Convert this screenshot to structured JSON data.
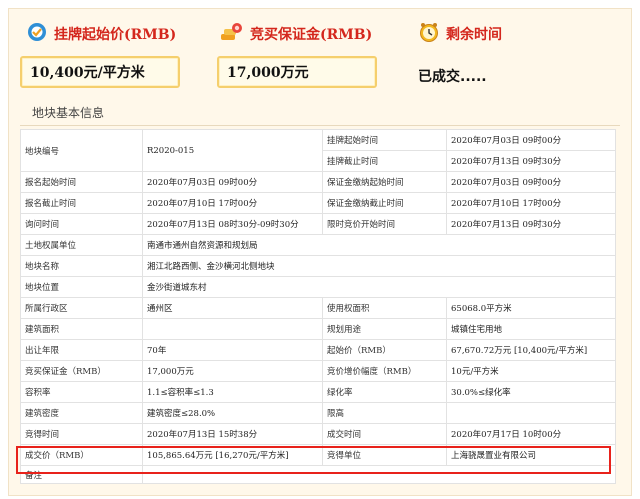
{
  "header": {
    "starting_price_label": "挂牌起始价(RMB)",
    "deposit_label": "竞买保证金(RMB)",
    "time_left_label": "剩余时间",
    "starting_price_value": "10,400元/平方米",
    "deposit_value": "17,000万元",
    "status": "已成交....."
  },
  "icons": {
    "price": "price-tag-icon",
    "deposit": "coin-stack-icon",
    "time": "alarm-clock-icon"
  },
  "section": {
    "title": "地块基本信息"
  },
  "table": {
    "r1": {
      "label_a": "地块编号",
      "value_a": "R2020-015",
      "label_b1": "挂牌起始时间",
      "value_b1": "2020年07月03日 09时00分",
      "label_b2": "挂牌截止时间",
      "value_b2": "2020年07月13日 09时30分"
    },
    "r2": {
      "label_a": "报名起始时间",
      "value_a": "2020年07月03日 09时00分",
      "label_b": "保证金缴纳起始时间",
      "value_b": "2020年07月03日 09时00分"
    },
    "r3": {
      "label_a": "报名截止时间",
      "value_a": "2020年07月10日 17时00分",
      "label_b": "保证金缴纳截止时间",
      "value_b": "2020年07月10日 17时00分"
    },
    "r4": {
      "label_a": "询问时间",
      "value_a": "2020年07月13日 08时30分-09时30分",
      "label_b": "限时竞价开始时间",
      "value_b": "2020年07月13日 09时30分"
    },
    "r5": {
      "label": "土地权属单位",
      "value": "南通市通州自然资源和规划局"
    },
    "r6": {
      "label": "地块名称",
      "value": "湘江北路西侧、金沙横河北侧地块"
    },
    "r7": {
      "label": "地块位置",
      "value": "金沙街道城东村"
    },
    "r8": {
      "label_a": "所属行政区",
      "value_a": "通州区",
      "label_b": "使用权面积",
      "value_b": "65068.0平方米"
    },
    "r9": {
      "label_a": "建筑面积",
      "value_a": "",
      "label_b": "规划用途",
      "value_b": "城镇住宅用地"
    },
    "r10": {
      "label_a": "出让年限",
      "value_a": "70年",
      "label_b": "起始价（RMB）",
      "value_b": "67,670.72万元 [10,400元/平方米]"
    },
    "r11": {
      "label_a": "竞买保证金（RMB）",
      "value_a": "17,000万元",
      "label_b": "竞价增价幅度（RMB）",
      "value_b": "10元/平方米"
    },
    "r12": {
      "label_a": "容积率",
      "value_a": "1.1≤容积率≤1.3",
      "label_b": "绿化率",
      "value_b": "30.0%≤绿化率"
    },
    "r13": {
      "label_a": "建筑密度",
      "value_a": "建筑密度≤28.0%",
      "label_b": "限高",
      "value_b": ""
    },
    "r14": {
      "label_a": "竞得时间",
      "value_a": "2020年07月13日 15时38分",
      "label_b": "成交时间",
      "value_b": "2020年07月17日 10时00分"
    },
    "r15": {
      "label_a": "成交价（RMB）",
      "value_a": "105,865.64万元 [16,270元/平方米]",
      "label_b": "竞得单位",
      "value_b": "上海骁晟置业有限公司"
    },
    "r16": {
      "label": "备注",
      "value": ""
    }
  },
  "colors": {
    "accent_red": "#d4271d",
    "box_border": "#f5cf6d",
    "highlight": "#e8221b"
  }
}
